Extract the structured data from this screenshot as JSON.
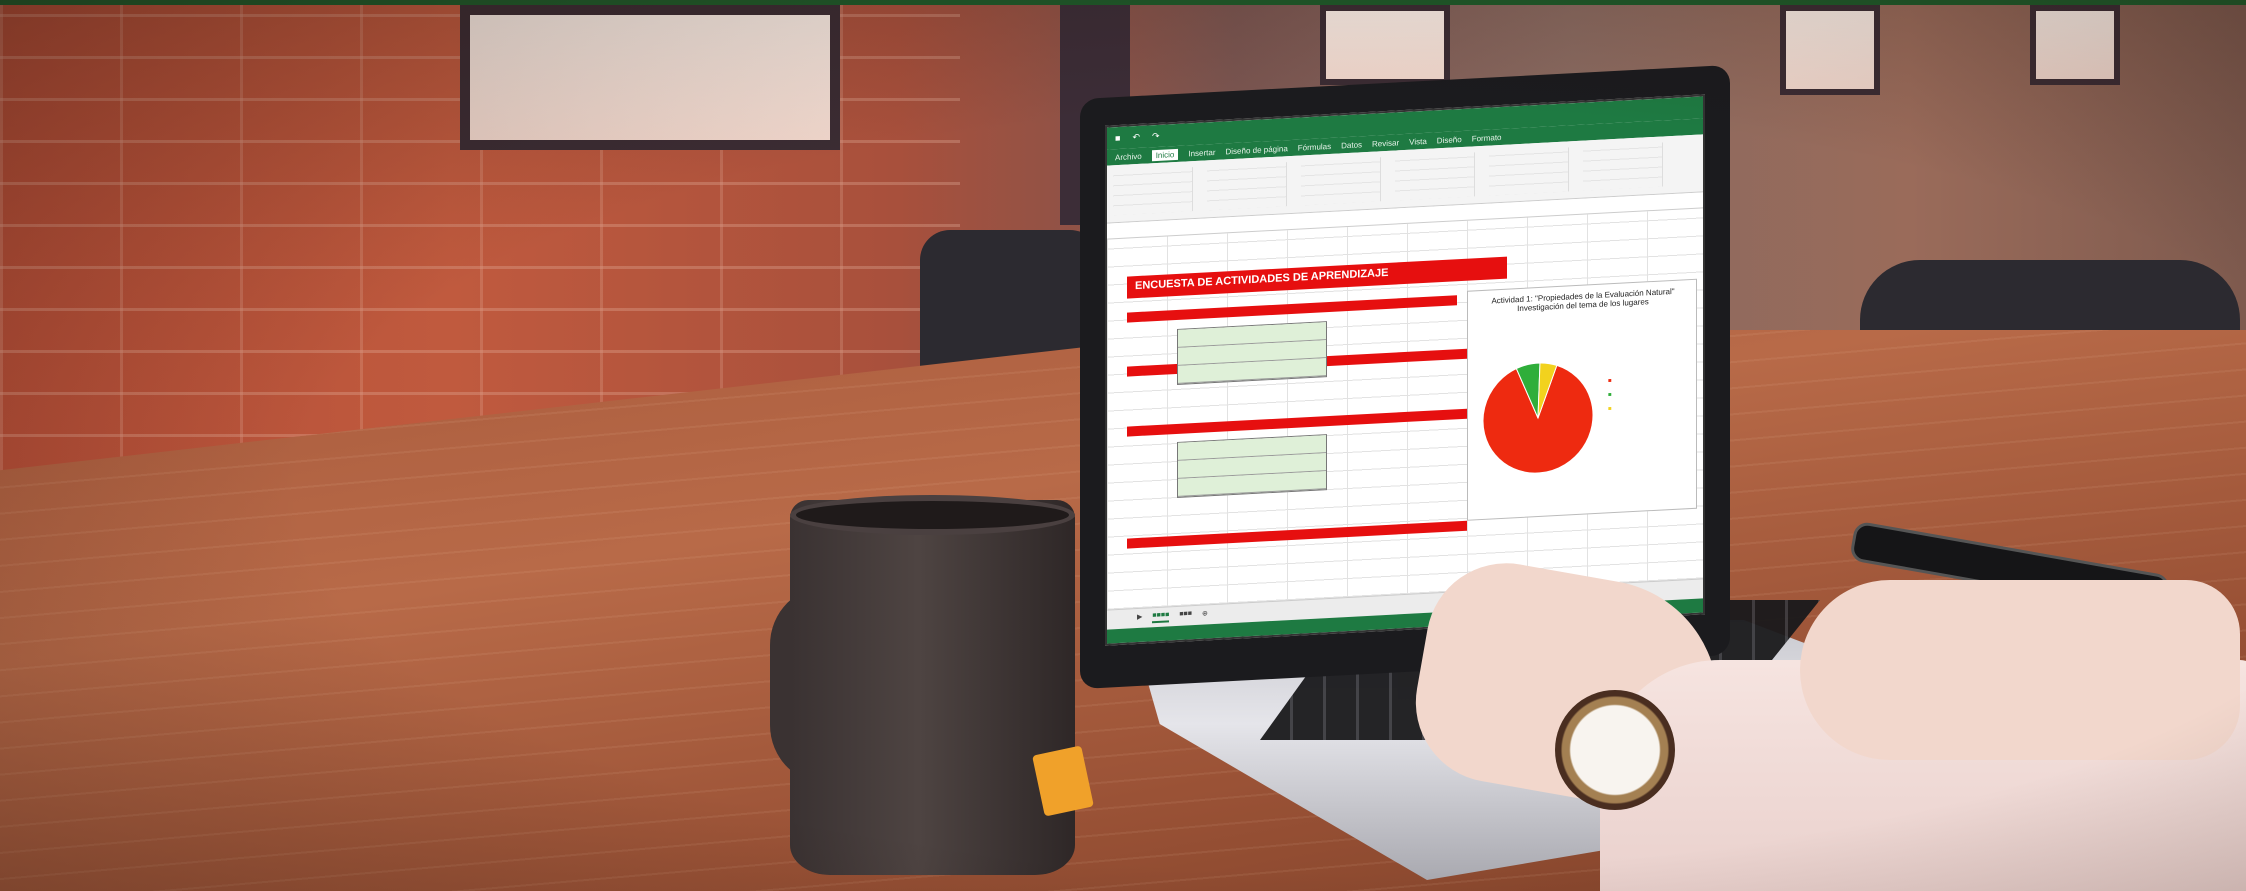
{
  "scene": {
    "description_colors": {
      "top_bar": "#1e5b2a",
      "excel_green": "#1e7a42",
      "banner_red": "#e60f0f",
      "pie_red": "#ee2a10",
      "pie_green": "#2fae3a",
      "pie_yellow": "#f2d21e"
    }
  },
  "excel": {
    "ribbon_tabs": [
      "Archivo",
      "Inicio",
      "Insertar",
      "Diseño de página",
      "Fórmulas",
      "Datos",
      "Revisar",
      "Vista",
      "Diseño",
      "Formato"
    ],
    "active_tab": "Inicio",
    "banner": "ENCUESTA DE ACTIVIDADES DE APRENDIZAJE",
    "chart_title": "Actividad 1: \"Propiedades de la Evaluación Natural\" Investigación del tema de los lugares"
  },
  "chart_data": {
    "type": "pie",
    "title": "Actividad 1: \"Propiedades de la Evaluación Natural\" Investigación del tema de los lugares",
    "values": [
      88,
      7,
      5
    ],
    "colors": [
      "#ee2a10",
      "#2fae3a",
      "#f2d21e"
    ]
  }
}
